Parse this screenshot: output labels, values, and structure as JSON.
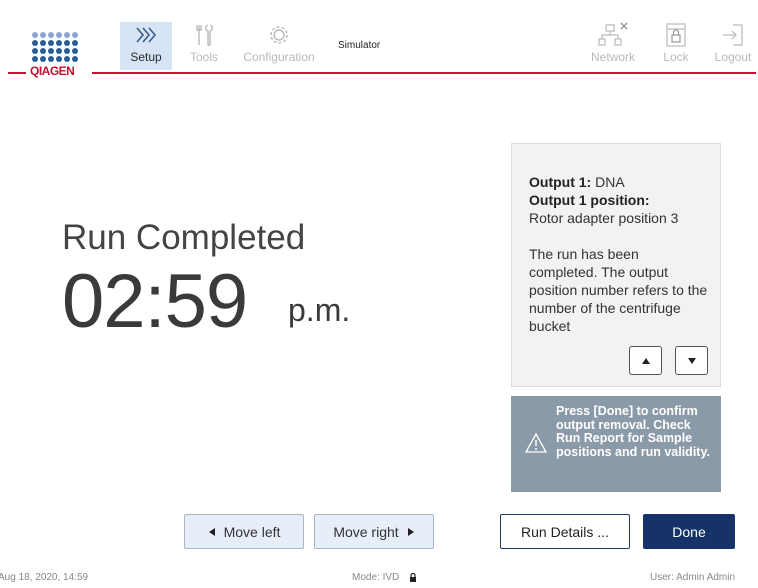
{
  "header": {
    "logo_text": "QIAGEN",
    "tabs": {
      "setup": "Setup",
      "tools": "Tools",
      "configuration": "Configuration",
      "network": "Network",
      "lock": "Lock",
      "logout": "Logout"
    },
    "active_tab": "Setup",
    "simulator_label": "Simulator"
  },
  "run": {
    "title": "Run Completed",
    "time": "02:59",
    "ampm": "p.m."
  },
  "info_panel": {
    "output_label": "Output 1:",
    "output_value": "DNA",
    "position_label": "Output 1 position:",
    "position_value": "Rotor adapter position 3",
    "message": "The run has been completed. The output position number refers to the number of the centrifuge bucket"
  },
  "warning": {
    "text": "Press [Done] to confirm output removal. Check Run Report for Sample positions and run validity."
  },
  "buttons": {
    "move_left": "Move left",
    "move_right": "Move right",
    "run_details": "Run Details ...",
    "done": "Done"
  },
  "footer": {
    "datetime": "Aug 18, 2020,  14:59",
    "mode": "Mode: IVD",
    "user": "User: Admin Admin"
  },
  "colors": {
    "brand_red": "#c4122f",
    "brand_blue": "#2c5d96",
    "active_tab_bg": "#d6e4f5",
    "warning_bg": "#8a9aa8",
    "done_button": "#153368"
  }
}
